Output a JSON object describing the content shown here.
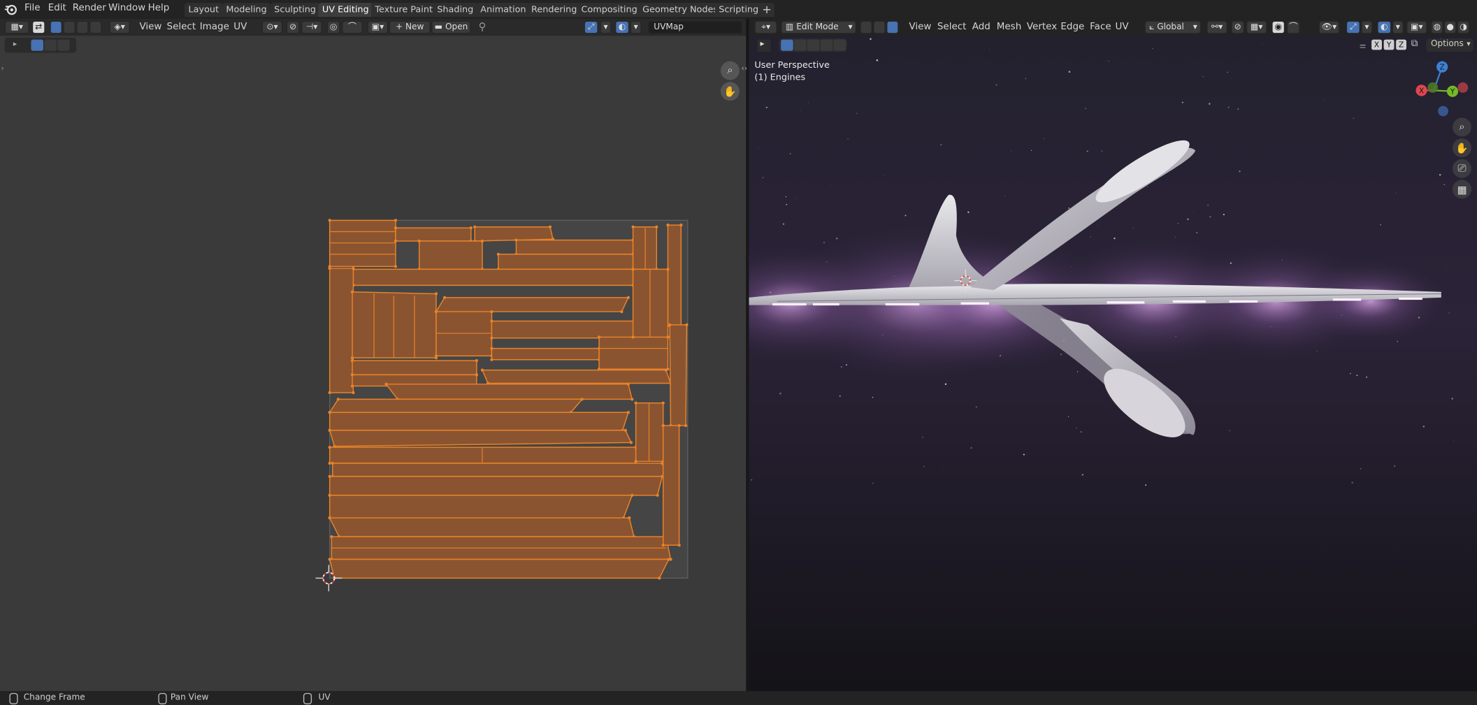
{
  "top_menu": [
    {
      "id": "file",
      "label": "File"
    },
    {
      "id": "edit",
      "label": "Edit"
    },
    {
      "id": "render",
      "label": "Render"
    },
    {
      "id": "window",
      "label": "Window"
    },
    {
      "id": "help",
      "label": "Help"
    }
  ],
  "workspace_tabs": [
    {
      "id": "layout",
      "label": "Layout",
      "active": false
    },
    {
      "id": "modeling",
      "label": "Modeling",
      "active": false
    },
    {
      "id": "sculpting",
      "label": "Sculpting",
      "active": false
    },
    {
      "id": "uv-editing",
      "label": "UV Editing",
      "active": true
    },
    {
      "id": "texture-paint",
      "label": "Texture Paint",
      "active": false
    },
    {
      "id": "shading",
      "label": "Shading",
      "active": false
    },
    {
      "id": "animation",
      "label": "Animation",
      "active": false
    },
    {
      "id": "rendering",
      "label": "Rendering",
      "active": false
    },
    {
      "id": "compositing",
      "label": "Compositing",
      "active": false
    },
    {
      "id": "geometry-nodes",
      "label": "Geometry Nodes",
      "active": false
    },
    {
      "id": "scripting",
      "label": "Scripting",
      "active": false
    }
  ],
  "add_workspace_icon": "plus-icon",
  "uv_editor": {
    "menus": [
      {
        "id": "view",
        "label": "View"
      },
      {
        "id": "select",
        "label": "Select"
      },
      {
        "id": "image",
        "label": "Image"
      },
      {
        "id": "uv",
        "label": "UV"
      }
    ],
    "new_label": "New",
    "open_label": "Open",
    "uv_map_value": "UVMap",
    "accent_color": "#e8822a",
    "island_fill": "#8a5430"
  },
  "viewport": {
    "mode_label": "Edit Mode",
    "menus": [
      {
        "id": "view",
        "label": "View"
      },
      {
        "id": "select",
        "label": "Select"
      },
      {
        "id": "add",
        "label": "Add"
      },
      {
        "id": "mesh",
        "label": "Mesh"
      },
      {
        "id": "vertex",
        "label": "Vertex"
      },
      {
        "id": "edge",
        "label": "Edge"
      },
      {
        "id": "face",
        "label": "Face"
      },
      {
        "id": "uv",
        "label": "UV"
      }
    ],
    "transform_orientation": "Global",
    "options_label": "Options",
    "mirror_axes": [
      "X",
      "Y",
      "Z"
    ],
    "overlay_line1": "User Perspective",
    "overlay_line2": "(1) Engines",
    "gizmo_axes": {
      "x": "X",
      "y": "Y",
      "z": "Z"
    },
    "axis_colors": {
      "x": "#e0464e",
      "y": "#74b928",
      "z": "#3b82d6"
    },
    "glow_color": "#d9a6e6"
  },
  "status_bar": [
    {
      "id": "change-frame",
      "label": "Change Frame"
    },
    {
      "id": "pan-view",
      "label": "Pan View"
    },
    {
      "id": "uv",
      "label": "UV"
    }
  ]
}
